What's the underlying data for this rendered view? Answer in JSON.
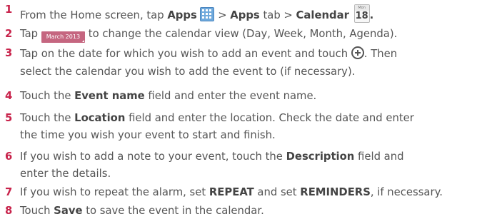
{
  "steps": [
    {
      "num": "1",
      "t1": "From the Home screen, tap ",
      "b1": "Apps",
      "t2": " > ",
      "b2": "Apps",
      "t3": " tab > ",
      "b3": "Calendar",
      "t4": "."
    },
    {
      "num": "2",
      "t1": "Tap ",
      "button": "March 2013",
      "t2": " to change the calendar view (Day, Week, Month, Agenda)."
    },
    {
      "num": "3",
      "l1": "Tap on the date for which you wish to add an event and touch ",
      "l1b": ". Then",
      "l2": "select the calendar you wish to add the event to (if necessary)."
    },
    {
      "num": "4",
      "t1": "Touch the ",
      "b1": "Event name",
      "t2": " field and enter the event name."
    },
    {
      "num": "5",
      "t1": "Touch the ",
      "b1": "Location",
      "t2": " field and enter the location. Check the date and enter",
      "l2": "the time you wish your event to start and finish."
    },
    {
      "num": "6",
      "t1": "If you wish to add a note to your event, touch the ",
      "b1": "Description",
      "t2": " field and",
      "l2": "enter the details."
    },
    {
      "num": "7",
      "t1": "If you wish to repeat the alarm, set ",
      "b1": "REPEAT",
      "t2": " and set ",
      "b2": "REMINDERS",
      "t3": ", if necessary."
    },
    {
      "num": "8",
      "t1": "Touch ",
      "b1": "Save",
      "t2": " to save the event in the calendar."
    }
  ],
  "calendar_icon": {
    "month": "Mon",
    "day": "18"
  },
  "icons": {
    "apps": "apps-grid-icon",
    "calendar": "calendar-icon",
    "add": "plus-circle-icon"
  },
  "colors": {
    "number": "#c8234b",
    "month_button": "#c56680",
    "apps_icon": "#6fa9dc"
  }
}
